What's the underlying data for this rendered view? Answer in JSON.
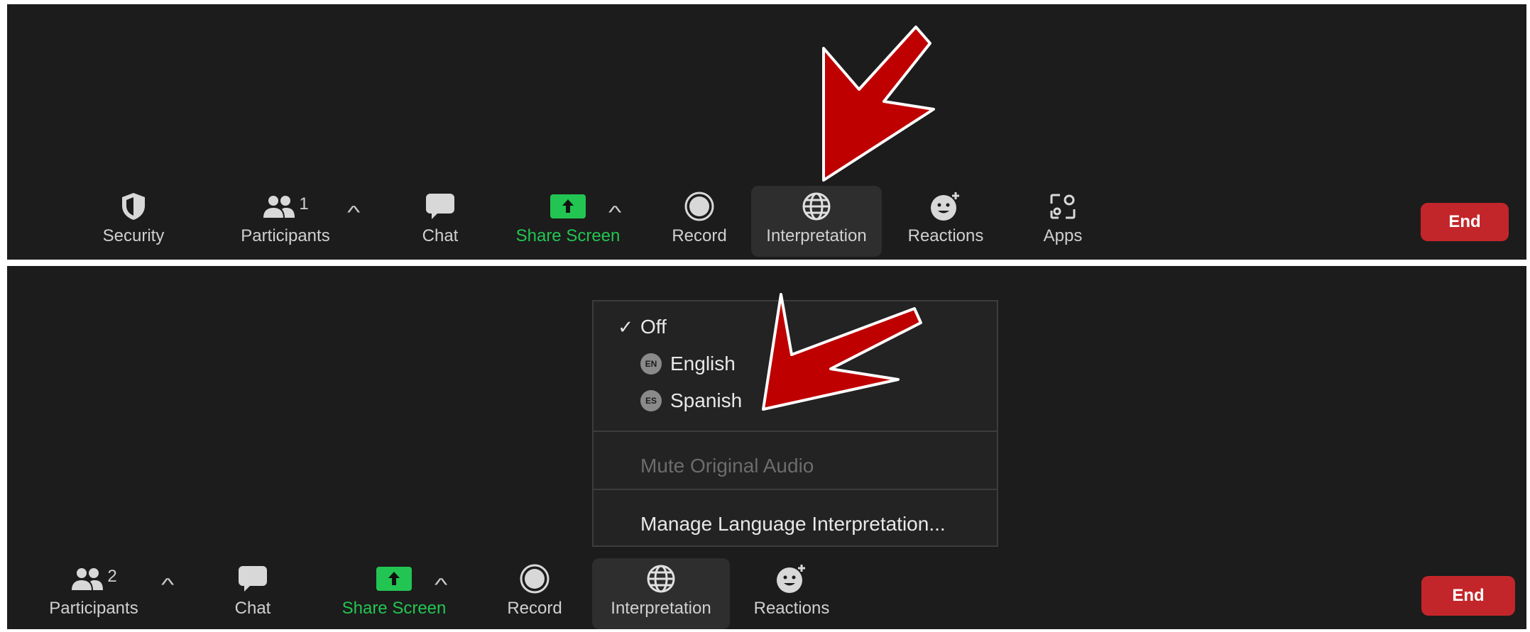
{
  "top_toolbar": {
    "security_label": "Security",
    "participants_label": "Participants",
    "participants_count": "1",
    "chat_label": "Chat",
    "share_label": "Share Screen",
    "record_label": "Record",
    "interpretation_label": "Interpretation",
    "reactions_label": "Reactions",
    "apps_label": "Apps",
    "end_label": "End"
  },
  "bottom_toolbar": {
    "participants_label": "Participants",
    "participants_count": "2",
    "chat_label": "Chat",
    "share_label": "Share Screen",
    "record_label": "Record",
    "interpretation_label": "Interpretation",
    "reactions_label": "Reactions",
    "end_label": "End"
  },
  "interpretation_menu": {
    "checkmark": "✓",
    "off_label": "Off",
    "english_badge": "EN",
    "english_label": "English",
    "spanish_badge": "ES",
    "spanish_label": "Spanish",
    "mute_label": "Mute Original Audio",
    "manage_label": "Manage Language Interpretation..."
  },
  "icons": [
    "shield-icon",
    "people-icon",
    "chevron-up-icon",
    "chat-bubble-icon",
    "share-screen-icon",
    "record-icon",
    "globe-icon",
    "reaction-smiley-icon",
    "apps-icon",
    "red-arrow-annotation"
  ],
  "colors": {
    "background": "#1c1c1c",
    "share_green": "#23c552",
    "end_red": "#c3262a",
    "arrow_red": "#bf0000",
    "active_button": "#2e2e2e"
  }
}
